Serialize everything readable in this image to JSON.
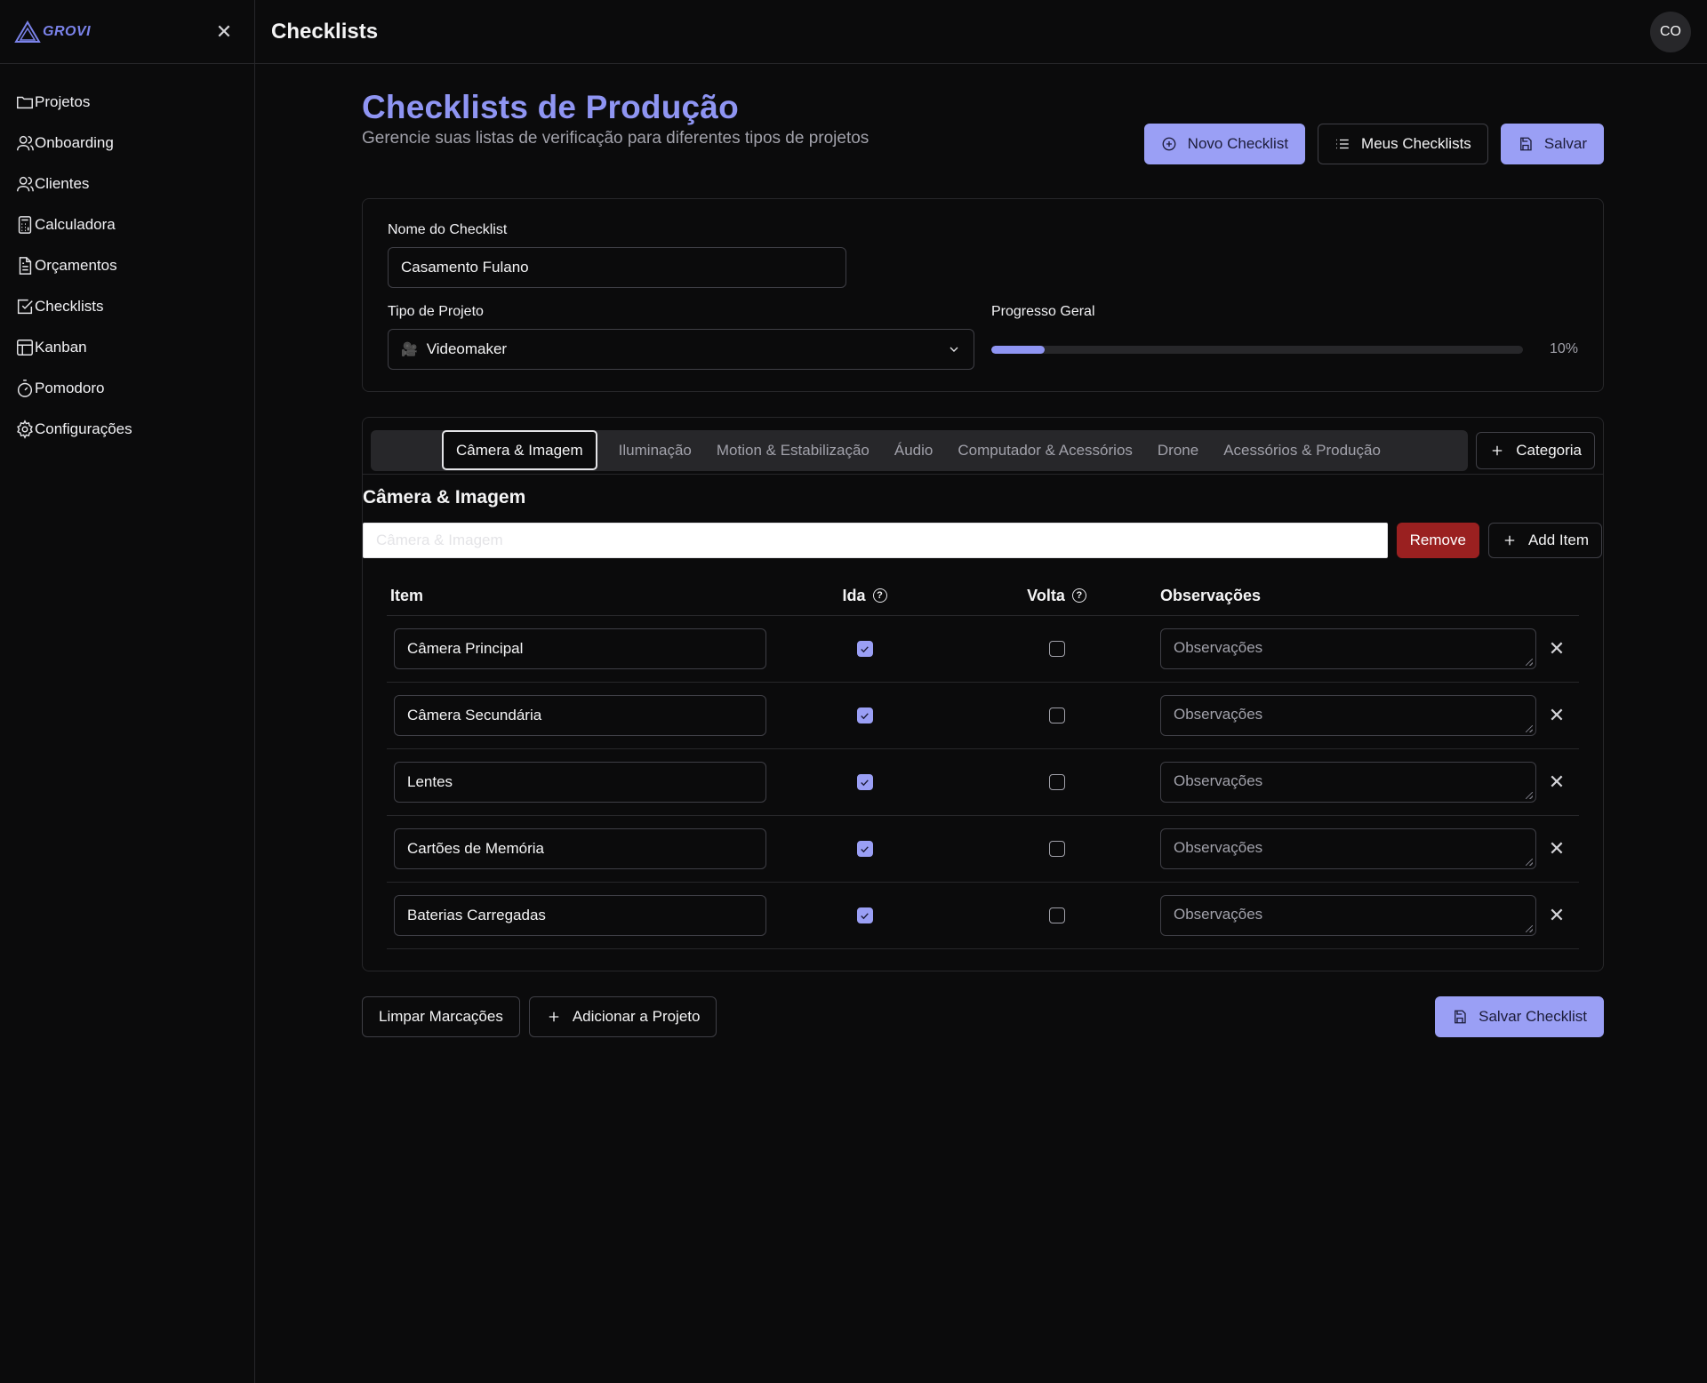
{
  "brand": {
    "logo_text": "GROVI",
    "accent": "#8f95f3"
  },
  "topbar": {
    "title": "Checklists",
    "avatar_initials": "CO"
  },
  "sidebar": {
    "items": [
      {
        "label": "Projetos",
        "icon": "folder-icon"
      },
      {
        "label": "Onboarding",
        "icon": "user-icon"
      },
      {
        "label": "Clientes",
        "icon": "users-icon"
      },
      {
        "label": "Calculadora",
        "icon": "calculator-icon"
      },
      {
        "label": "Orçamentos",
        "icon": "file-text-icon"
      },
      {
        "label": "Checklists",
        "icon": "check-square-icon"
      },
      {
        "label": "Kanban",
        "icon": "kanban-icon"
      },
      {
        "label": "Pomodoro",
        "icon": "timer-icon"
      },
      {
        "label": "Configurações",
        "icon": "gear-icon"
      }
    ]
  },
  "header": {
    "title": "Checklists de Produção",
    "subtitle": "Gerencie suas listas de verificação para diferentes tipos de projetos",
    "new_label": "Novo Checklist",
    "mine_label": "Meus Checklists",
    "save_label": "Salvar"
  },
  "meta": {
    "name_label": "Nome do Checklist",
    "name_value": "Casamento Fulano",
    "type_label": "Tipo de Projeto",
    "type_value": "Videomaker",
    "progress_label": "Progresso Geral",
    "progress_text": "10%",
    "progress_fraction": 0.1
  },
  "tabs": {
    "items": [
      "Câmera & Imagem",
      "Iluminação",
      "Motion & Estabilização",
      "Áudio",
      "Computador & Acessórios",
      "Drone",
      "Acessórios & Produção"
    ],
    "active": 0,
    "add_category_label": "Categoria"
  },
  "category": {
    "title": "Câmera & Imagem",
    "input_placeholder": "Câmera & Imagem",
    "remove_label": "Remove",
    "add_item_label": "Add Item"
  },
  "table": {
    "headers": {
      "item": "Item",
      "ida": "Ida",
      "volta": "Volta",
      "obs": "Observações"
    },
    "obs_placeholder": "Observações",
    "rows": [
      {
        "item": "Câmera Principal",
        "ida": true,
        "volta": false
      },
      {
        "item": "Câmera Secundária",
        "ida": true,
        "volta": false
      },
      {
        "item": "Lentes",
        "ida": true,
        "volta": false
      },
      {
        "item": "Cartões de Memória",
        "ida": true,
        "volta": false
      },
      {
        "item": "Baterias Carregadas",
        "ida": true,
        "volta": false
      }
    ]
  },
  "footer": {
    "clear_label": "Limpar Marcações",
    "add_project_label": "Adicionar a Projeto",
    "save_checklist_label": "Salvar Checklist"
  }
}
